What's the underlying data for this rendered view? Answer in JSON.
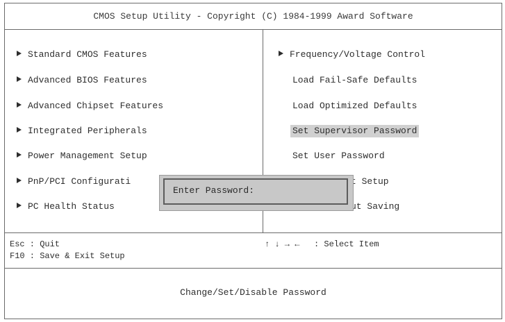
{
  "header": {
    "title": "CMOS Setup Utility - Copyright (C) 1984-1999 Award Software"
  },
  "menu_left": [
    {
      "label": "Standard CMOS Features"
    },
    {
      "label": "Advanced BIOS Features"
    },
    {
      "label": "Advanced Chipset Features"
    },
    {
      "label": "Integrated Peripherals"
    },
    {
      "label": "Power Management Setup"
    },
    {
      "label": "PnP/PCI Configurati"
    },
    {
      "label": "PC Health Status"
    }
  ],
  "menu_right": [
    {
      "label": "Frequency/Voltage Control"
    },
    {
      "label": "Load Fail-Safe Defaults"
    },
    {
      "label": "Load Optimized Defaults"
    },
    {
      "label": "Set Supervisor Password"
    },
    {
      "label": "Set User Password"
    },
    {
      "label": "t Setup"
    },
    {
      "label": "ut Saving"
    }
  ],
  "footer": {
    "esc_hint": "Esc : Quit",
    "f10_hint": "F10 : Save & Exit Setup",
    "nav_arrows": "↑ ↓ → ←",
    "nav_hint": ": Select Item"
  },
  "help_text": "Change/Set/Disable Password",
  "dialog": {
    "label": "Enter Password:"
  },
  "icons": {
    "menu_arrow": "right-triangle-arrow-icon"
  }
}
